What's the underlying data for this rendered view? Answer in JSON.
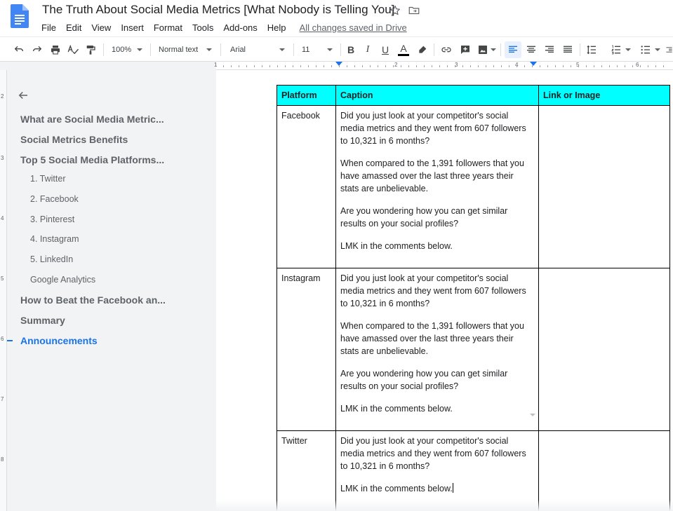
{
  "doc": {
    "title": "The Truth About Social Media Metrics [What Nobody is Telling You]",
    "save_status": "All changes saved in Drive"
  },
  "menu": [
    "File",
    "Edit",
    "View",
    "Insert",
    "Format",
    "Tools",
    "Add-ons",
    "Help"
  ],
  "toolbar": {
    "zoom": "100%",
    "style": "Normal text",
    "font": "Arial",
    "font_size": "11",
    "bold_glyph": "B",
    "italic_glyph": "I",
    "underline_glyph": "U",
    "text_color_glyph": "A"
  },
  "ruler": {
    "numbers": [
      "1",
      "2",
      "3",
      "4",
      "5",
      "6"
    ]
  },
  "vruler": {
    "numbers": [
      "2",
      "3",
      "4",
      "5",
      "6",
      "7",
      "8"
    ]
  },
  "outline": {
    "items": [
      {
        "label": "What are Social Media Metric...",
        "level": 1
      },
      {
        "label": "Social Metrics Benefits",
        "level": 1
      },
      {
        "label": "Top 5 Social Media Platforms...",
        "level": 1
      },
      {
        "label": "1. Twitter",
        "level": 2
      },
      {
        "label": "2. Facebook",
        "level": 2
      },
      {
        "label": "3. Pinterest",
        "level": 2
      },
      {
        "label": "4. Instagram",
        "level": 2
      },
      {
        "label": "5. LinkedIn",
        "level": 2
      },
      {
        "label": "Google Analytics",
        "level": 2
      },
      {
        "label": "How to Beat the Facebook an...",
        "level": 1
      },
      {
        "label": "Summary",
        "level": 1
      },
      {
        "label": "Announcements",
        "level": 1,
        "active": true
      }
    ]
  },
  "table": {
    "headers": [
      "Platform",
      "Caption",
      "Link or Image"
    ],
    "rows": [
      {
        "platform": "Facebook",
        "caption": [
          "Did you just look at your competitor's social media metrics and they went from 607 followers to 10,321 in 6 months?",
          "When compared to the 1,391 followers that you have amassed over the last three years their stats are unbelievable.",
          "Are you wondering how you can get similar results on your social profiles?",
          "LMK in the comments below."
        ],
        "link": ""
      },
      {
        "platform": "Instagram",
        "caption": [
          "Did you just look at your competitor's social media metrics and they went from 607 followers to 10,321 in 6 months?",
          "When compared to the 1,391 followers that you have amassed over the last three years their stats are unbelievable.",
          "Are you wondering how you can get similar results on your social profiles?",
          "LMK in the comments below."
        ],
        "link": ""
      },
      {
        "platform": "Twitter",
        "caption": [
          "Did you just look at your competitor's social media metrics and they went from 607 followers to 10,321 in 6 months?",
          "LMK in the comments below."
        ],
        "link": ""
      }
    ]
  },
  "colors": {
    "header_fill": "#00ffff",
    "accent": "#1a73e8",
    "docs_blue": "#4285f4"
  }
}
